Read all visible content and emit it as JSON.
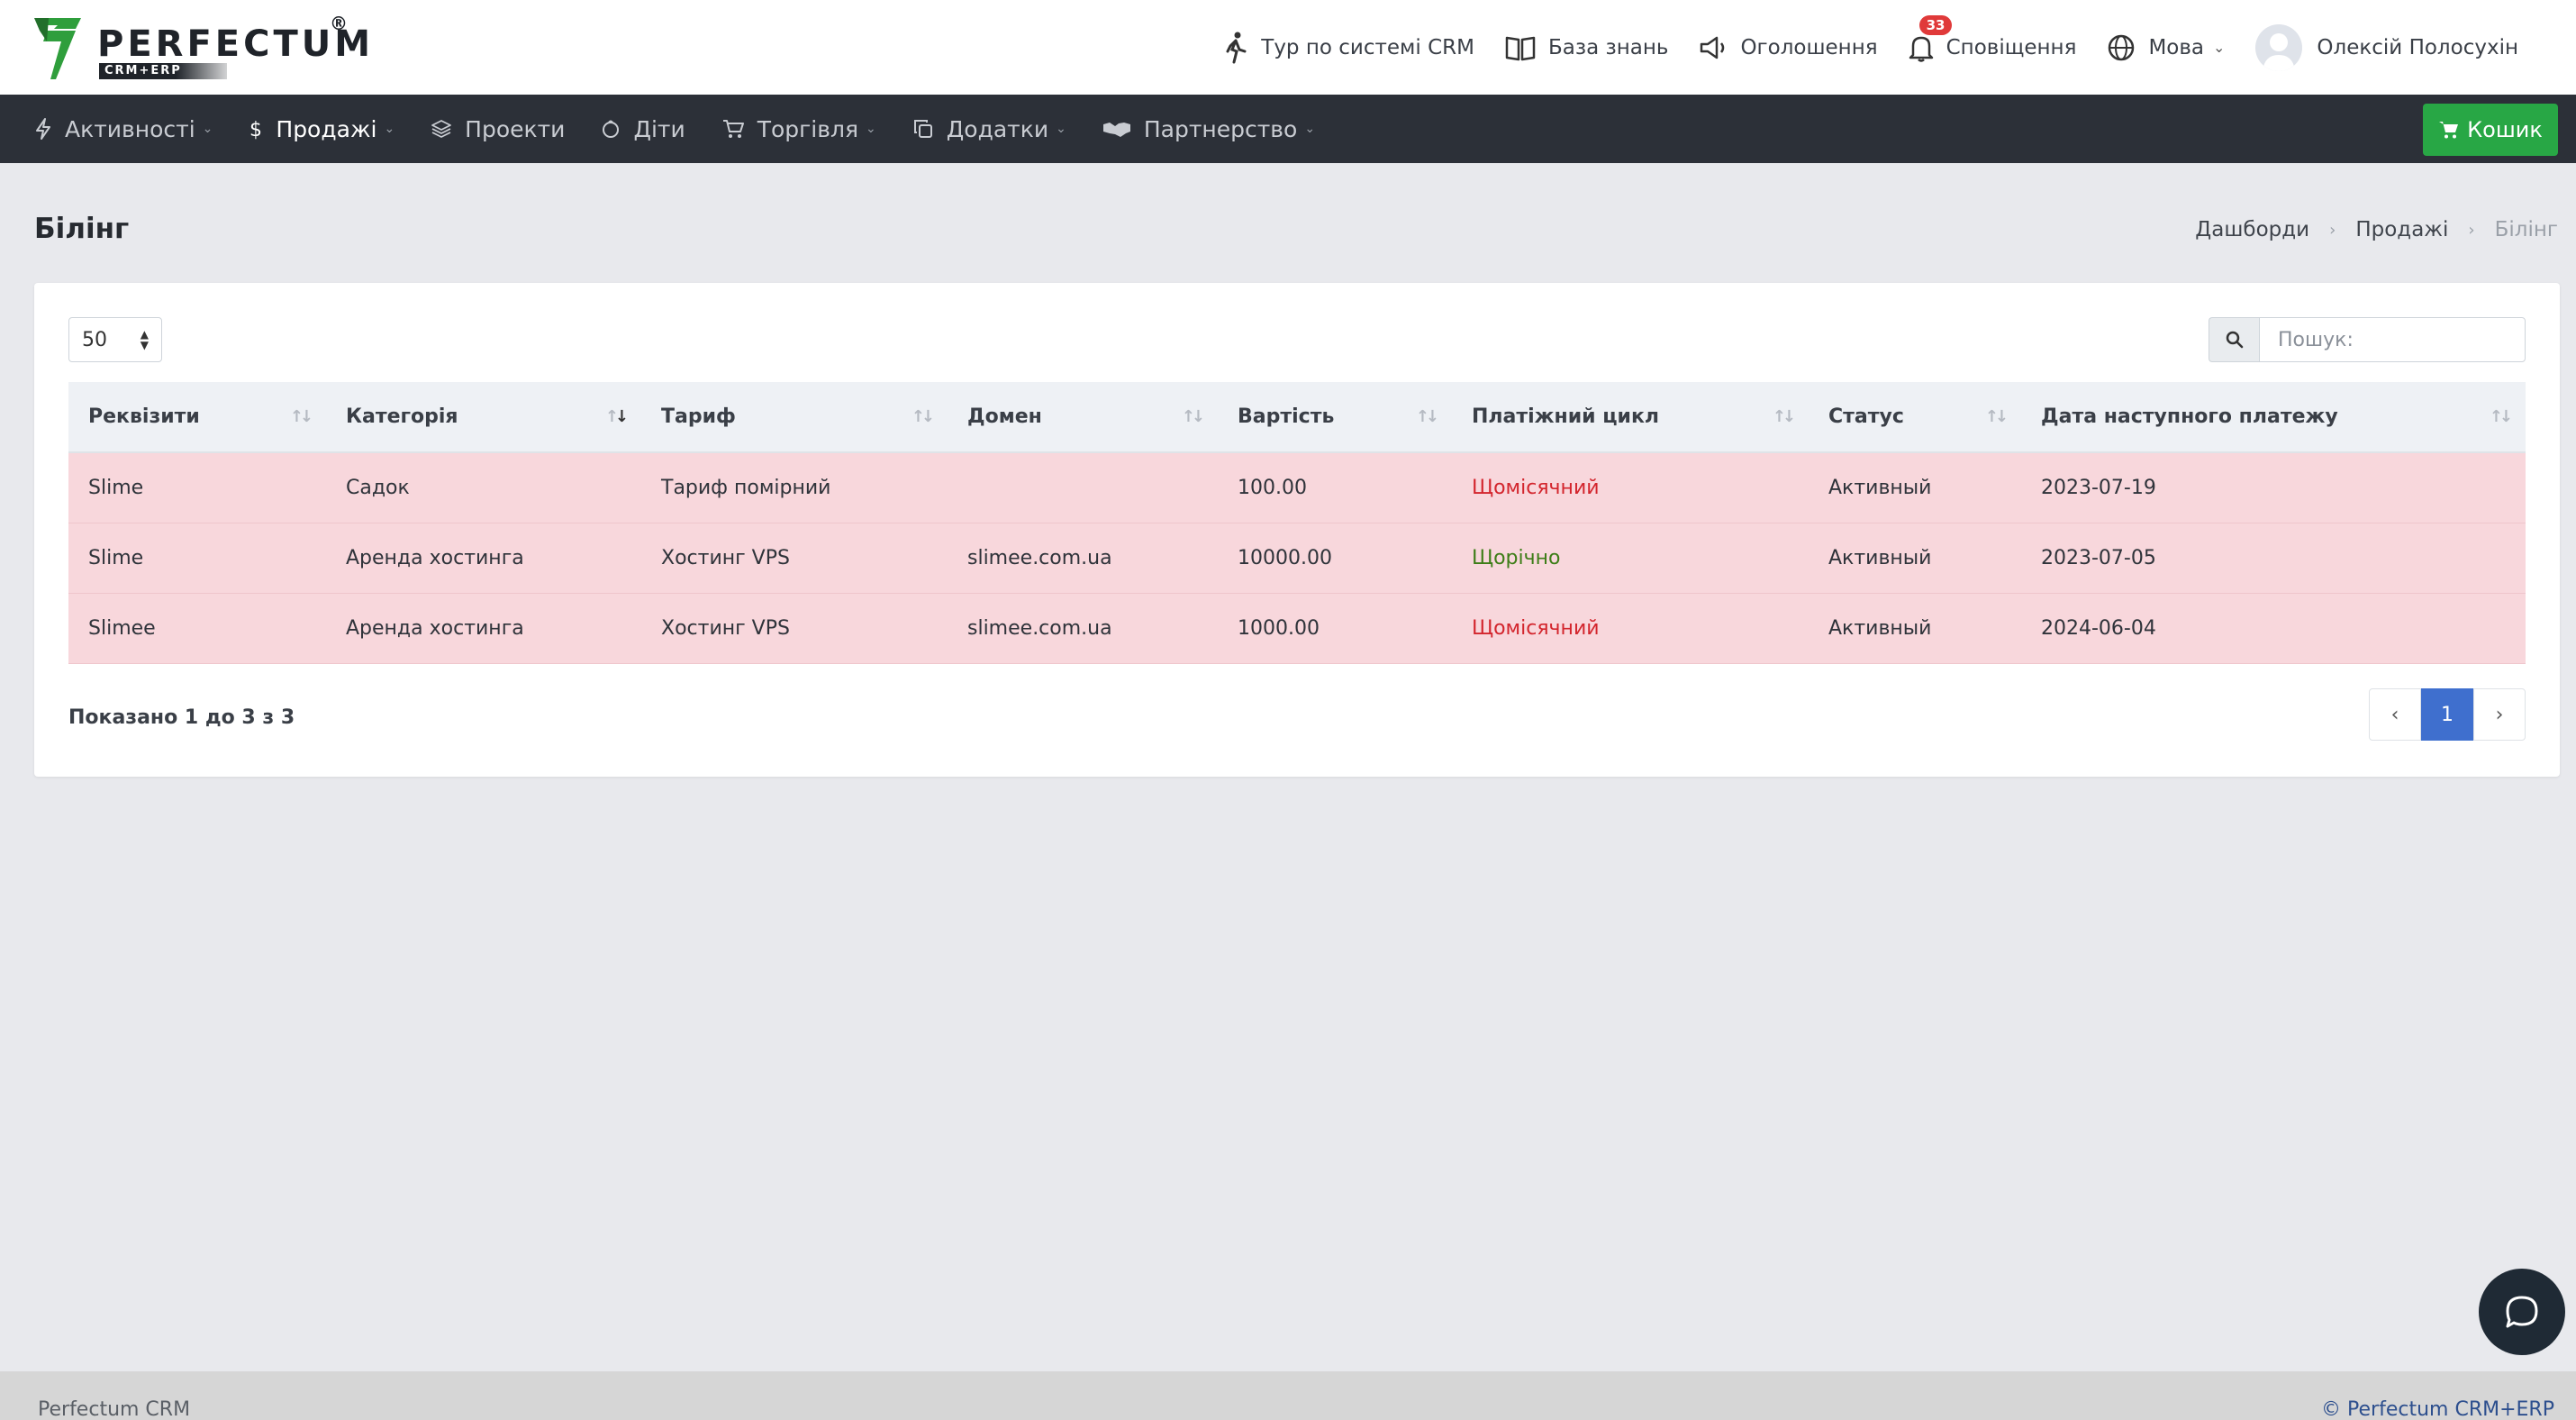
{
  "brand": {
    "name": "PERFECTUM",
    "sub": "CRM+ERP",
    "reg": "®"
  },
  "top": {
    "tour": "Тур по системі CRM",
    "kb": "База знань",
    "announce": "Оголошення",
    "notif": "Сповіщення",
    "notif_count": "33",
    "lang": "Мова",
    "user": "Олексій Полосухін"
  },
  "nav": {
    "items": [
      {
        "label": "Активності"
      },
      {
        "label": "Продажі"
      },
      {
        "label": "Проекти"
      },
      {
        "label": "Діти"
      },
      {
        "label": "Торгівля"
      },
      {
        "label": "Додатки"
      },
      {
        "label": "Партнерство"
      }
    ],
    "cart": "Кошик"
  },
  "page": {
    "title": "Білінг",
    "breadcrumb": [
      "Дашборди",
      "Продажі",
      "Білінг"
    ]
  },
  "table": {
    "page_size": "50",
    "search_placeholder": "Пошук:",
    "headers": [
      "Реквізити",
      "Категорія",
      "Тариф",
      "Домен",
      "Вартість",
      "Платіжний цикл",
      "Статус",
      "Дата наступного платежу"
    ],
    "rows": [
      [
        "Slime",
        "Садок",
        "Тариф помірний",
        "",
        "100.00",
        "Щомісячний",
        "Активный",
        "2023-07-19"
      ],
      [
        "Slime",
        "Аренда хостинга",
        "Хостинг VPS",
        "slimee.com.ua",
        "10000.00",
        "Щорічно",
        "Активный",
        "2023-07-05"
      ],
      [
        "Slimee",
        "Аренда хостинга",
        "Хостинг VPS",
        "slimee.com.ua",
        "1000.00",
        "Щомісячний",
        "Активный",
        "2024-06-04"
      ]
    ],
    "info": "Показано 1 до 3 з 3",
    "current_page": "1"
  },
  "footer": {
    "left": "Perfectum CRM",
    "right": "© Perfectum CRM+ERP"
  },
  "colors": {
    "accent": "#3f6fce",
    "cart": "#28a745",
    "row": "#f8d7dc",
    "nav": "#2c3038"
  }
}
